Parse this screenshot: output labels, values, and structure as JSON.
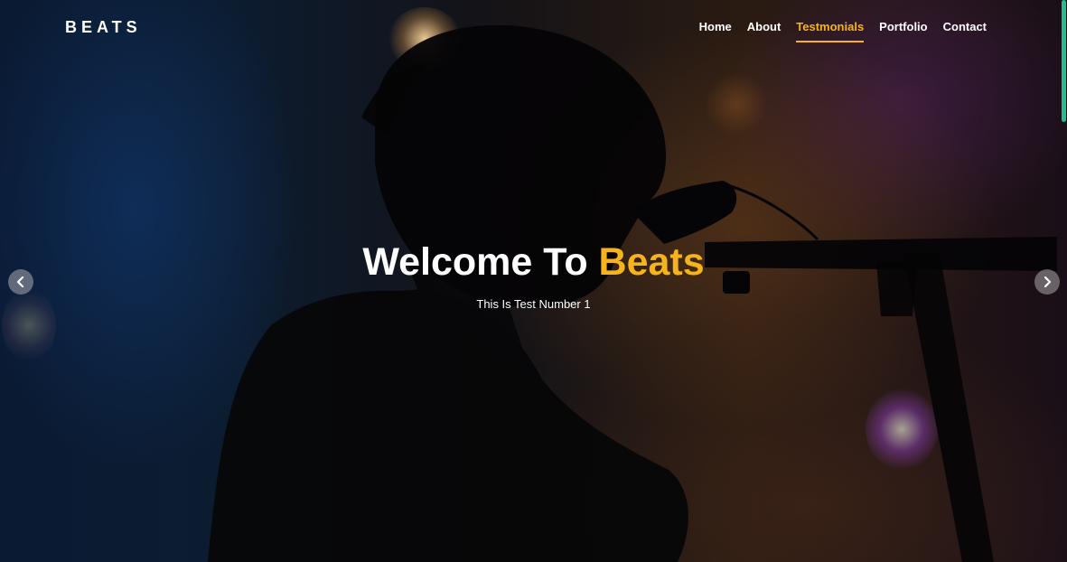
{
  "brand": {
    "name": "BEATS"
  },
  "nav": {
    "items": [
      {
        "label": "Home",
        "active": false
      },
      {
        "label": "About",
        "active": false
      },
      {
        "label": "Testmonials",
        "active": true
      },
      {
        "label": "Portfolio",
        "active": false
      },
      {
        "label": "Contact",
        "active": false
      }
    ]
  },
  "hero": {
    "title_prefix": "Welcome To ",
    "title_highlight": "Beats",
    "subtitle": "This Is Test Number 1"
  },
  "carousel": {
    "prev_icon": "chevron-left-icon",
    "next_icon": "chevron-right-icon"
  },
  "colors": {
    "accent": "#f5b31c",
    "text": "#ffffff",
    "scrollbar": "#1fbf8f"
  }
}
